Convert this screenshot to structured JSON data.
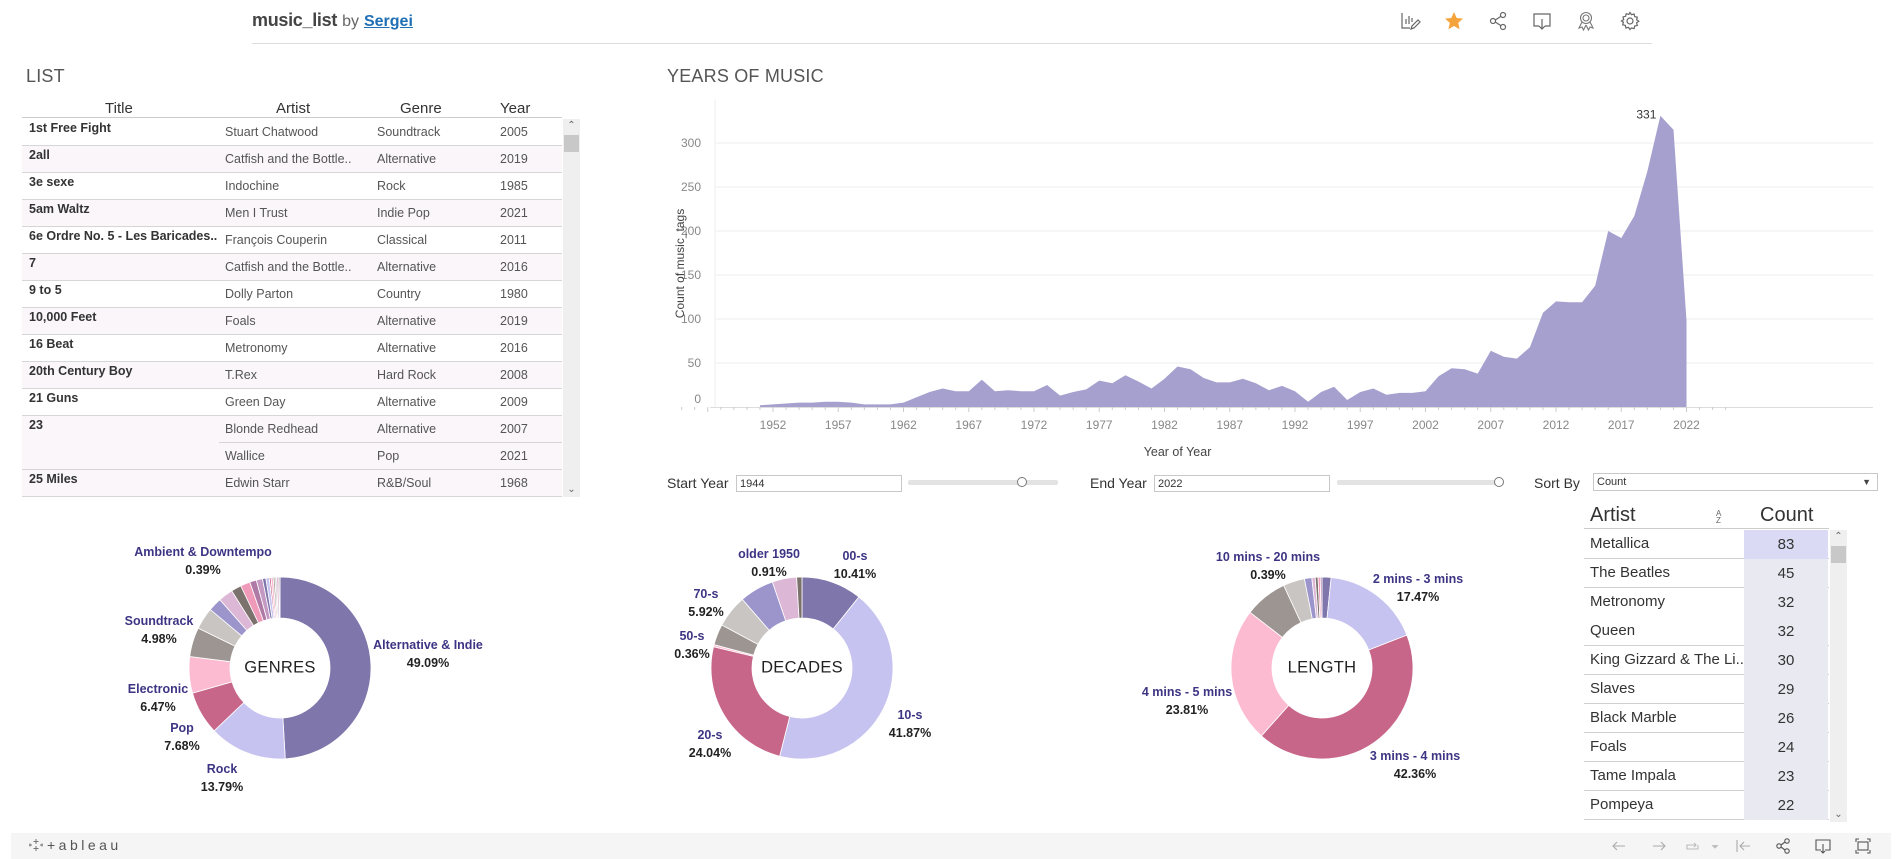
{
  "header": {
    "workbook_name": "music_list",
    "by_label": "by",
    "author": "Sergei",
    "icons": [
      "edit-viz-icon",
      "favorite-star-icon",
      "share-icon",
      "download-icon",
      "badge-icon",
      "settings-gear-icon"
    ],
    "star_color": "#f5a43b"
  },
  "list": {
    "title": "LIST",
    "columns": [
      "Title",
      "Artist",
      "Genre",
      "Year"
    ],
    "rows": [
      {
        "title": "1st Free Fight",
        "artist": "Stuart Chatwood",
        "genre": "Soundtrack",
        "year": "2005"
      },
      {
        "title": "2all",
        "artist": "Catfish and the Bottle..",
        "genre": "Alternative",
        "year": "2019"
      },
      {
        "title": "3e sexe",
        "artist": "Indochine",
        "genre": "Rock",
        "year": "1985"
      },
      {
        "title": "5am Waltz",
        "artist": "Men I Trust",
        "genre": "Indie Pop",
        "year": "2021"
      },
      {
        "title": "6e Ordre No. 5 - Les Baricades..",
        "artist": "François Couperin",
        "genre": "Classical",
        "year": "2011"
      },
      {
        "title": "7",
        "artist": "Catfish and the Bottle..",
        "genre": "Alternative",
        "year": "2016"
      },
      {
        "title": "9 to 5",
        "artist": "Dolly Parton",
        "genre": "Country",
        "year": "1980"
      },
      {
        "title": "10,000 Feet",
        "artist": "Foals",
        "genre": "Alternative",
        "year": "2019"
      },
      {
        "title": "16 Beat",
        "artist": "Metronomy",
        "genre": "Alternative",
        "year": "2016"
      },
      {
        "title": "20th Century Boy",
        "artist": "T.Rex",
        "genre": "Hard Rock",
        "year": "2008"
      },
      {
        "title": "21 Guns",
        "artist": "Green Day",
        "genre": "Alternative",
        "year": "2009"
      },
      {
        "title": "23",
        "artist": "Blonde Redhead",
        "genre": "Alternative",
        "year": "2007"
      },
      {
        "title": "",
        "artist": "Wallice",
        "genre": "Pop",
        "year": "2021"
      },
      {
        "title": "25 Miles",
        "artist": "Edwin Starr",
        "genre": "R&B/Soul",
        "year": "1968"
      }
    ]
  },
  "years_section": {
    "title": "YEARS OF MUSIC"
  },
  "filters": {
    "start_year_label": "Start Year",
    "start_year_value": "1944",
    "start_slider_fraction": 0.76,
    "end_year_label": "End Year",
    "end_year_value": "2022",
    "end_slider_fraction": 1.0,
    "sort_by_label": "Sort By",
    "sort_by_value": "Count"
  },
  "artists": {
    "columns": [
      "Artist",
      "Count"
    ],
    "sort_icon": "sort-az-icon",
    "rows": [
      {
        "artist": "Metallica",
        "count": "83"
      },
      {
        "artist": "The Beatles",
        "count": "45"
      },
      {
        "artist": "Metronomy",
        "count": "32"
      },
      {
        "artist": "Queen",
        "count": "32"
      },
      {
        "artist": "King Gizzard & The Li..",
        "count": "30"
      },
      {
        "artist": "Slaves",
        "count": "29"
      },
      {
        "artist": "Black Marble",
        "count": "26"
      },
      {
        "artist": "Foals",
        "count": "24"
      },
      {
        "artist": "Tame Impala",
        "count": "23"
      },
      {
        "artist": "Pompeya",
        "count": "22"
      }
    ]
  },
  "footer": {
    "logo_text": "+ableau",
    "icons": [
      "undo-icon",
      "redo-icon",
      "revert-icon",
      "revert-dropdown-icon",
      "reset-icon",
      "share-icon",
      "download-icon",
      "fullscreen-icon"
    ]
  },
  "chart_data": [
    {
      "type": "area",
      "title": "YEARS OF MUSIC",
      "xlabel": "Year of Year",
      "ylabel": "Count of music_tags",
      "ylim": [
        0,
        345
      ],
      "xlim": [
        1944,
        2025
      ],
      "yticks": [
        0,
        50,
        100,
        150,
        200,
        250,
        300
      ],
      "xticks": [
        1952,
        1957,
        1962,
        1967,
        1972,
        1977,
        1982,
        1987,
        1992,
        1997,
        2002,
        2007,
        2012,
        2017,
        2022
      ],
      "grid": true,
      "color": "#a5a0ce",
      "annotation": {
        "x": 2020,
        "y": 331,
        "text": "331"
      },
      "x": [
        1951,
        1952,
        1953,
        1954,
        1955,
        1956,
        1957,
        1958,
        1959,
        1960,
        1961,
        1962,
        1963,
        1964,
        1965,
        1966,
        1967,
        1968,
        1969,
        1970,
        1971,
        1972,
        1973,
        1974,
        1975,
        1976,
        1977,
        1978,
        1979,
        1980,
        1981,
        1982,
        1983,
        1984,
        1985,
        1986,
        1987,
        1988,
        1989,
        1990,
        1991,
        1992,
        1993,
        1994,
        1995,
        1996,
        1997,
        1998,
        1999,
        2000,
        2001,
        2002,
        2003,
        2004,
        2005,
        2006,
        2007,
        2008,
        2009,
        2010,
        2011,
        2012,
        2013,
        2014,
        2015,
        2016,
        2017,
        2018,
        2019,
        2020,
        2021,
        2022
      ],
      "values": [
        2,
        3,
        4,
        5,
        5,
        6,
        6,
        5,
        3,
        3,
        3,
        5,
        11,
        17,
        21,
        18,
        18,
        31,
        18,
        19,
        18,
        18,
        25,
        13,
        17,
        20,
        30,
        27,
        36,
        29,
        21,
        32,
        46,
        43,
        33,
        28,
        28,
        32,
        27,
        19,
        24,
        18,
        6,
        17,
        23,
        8,
        17,
        21,
        14,
        16,
        16,
        18,
        35,
        44,
        43,
        38,
        64,
        57,
        55,
        68,
        107,
        120,
        119,
        119,
        138,
        200,
        192,
        217,
        268,
        331,
        315,
        98
      ]
    },
    {
      "type": "pie",
      "title": "GENRES",
      "slices": [
        {
          "label": "Alternative & Indie",
          "value": 49.09,
          "color": "#7f76ab",
          "show_label": true
        },
        {
          "label": "Rock",
          "value": 13.79,
          "color": "#c7c3f0",
          "show_label": true
        },
        {
          "label": "Pop",
          "value": 7.68,
          "color": "#c76688",
          "show_label": true
        },
        {
          "label": "Electronic",
          "value": 6.47,
          "color": "#fdbbd2",
          "show_label": true
        },
        {
          "label": "",
          "value": 5.2,
          "color": "#9d9591",
          "show_label": false
        },
        {
          "label": "",
          "value": 3.9,
          "color": "#c9c5c2",
          "show_label": false
        },
        {
          "label": "Soundtrack",
          "value": 2.4,
          "color": "#9b95cc",
          "show_label": true,
          "display_pct": "4.98%"
        },
        {
          "label": "",
          "value": 2.6,
          "color": "#dcb7d6",
          "show_label": false
        },
        {
          "label": "",
          "value": 1.8,
          "color": "#7b716d",
          "show_label": false
        },
        {
          "label": "",
          "value": 1.7,
          "color": "#f09aba",
          "show_label": false
        },
        {
          "label": "",
          "value": 1.2,
          "color": "#b07aa6",
          "show_label": false
        },
        {
          "label": "",
          "value": 1.1,
          "color": "#c499c3",
          "show_label": false
        },
        {
          "label": "",
          "value": 0.6,
          "color": "#7f76ab",
          "show_label": false
        },
        {
          "label": "",
          "value": 0.6,
          "color": "#c7c3f0",
          "show_label": false
        },
        {
          "label": "",
          "value": 0.3,
          "color": "#c76688",
          "show_label": false
        },
        {
          "label": "",
          "value": 0.4,
          "color": "#fdbbd2",
          "show_label": false
        },
        {
          "label": "",
          "value": 0.3,
          "color": "#9d9591",
          "show_label": false
        },
        {
          "label": "",
          "value": 0.3,
          "color": "#c9c5c2",
          "show_label": false
        },
        {
          "label": "Ambient & Downtempo",
          "value": 0.39,
          "color": "#dcb7d6",
          "show_label": true
        },
        {
          "label": "",
          "value": 0.2,
          "color": "#7b716d",
          "show_label": false
        }
      ],
      "labels": [
        {
          "name": "Alternative & Indie",
          "pct": "49.09%"
        },
        {
          "name": "Rock",
          "pct": "13.79%"
        },
        {
          "name": "Pop",
          "pct": "7.68%"
        },
        {
          "name": "Electronic",
          "pct": "6.47%"
        },
        {
          "name": "Soundtrack",
          "pct": "4.98%"
        },
        {
          "name": "Ambient & Downtempo",
          "pct": "0.39%"
        }
      ]
    },
    {
      "type": "pie",
      "title": "DECADES",
      "slices": [
        {
          "label": "00-s",
          "value": 10.41,
          "color": "#7f76ab"
        },
        {
          "label": "10-s",
          "value": 41.87,
          "color": "#c7c3f0"
        },
        {
          "label": "20-s",
          "value": 24.04,
          "color": "#c76688"
        },
        {
          "label": "50-s",
          "value": 0.36,
          "color": "#fdbbd2"
        },
        {
          "label": "",
          "value": 3.6,
          "color": "#9d9591"
        },
        {
          "label": "",
          "value": 5.6,
          "color": "#c9c5c2"
        },
        {
          "label": "70-s",
          "value": 5.92,
          "color": "#9b95cc"
        },
        {
          "label": "",
          "value": 4.2,
          "color": "#dcb7d6"
        },
        {
          "label": "older 1950",
          "value": 0.91,
          "color": "#7b716d"
        }
      ],
      "labels": [
        {
          "name": "00-s",
          "pct": "10.41%"
        },
        {
          "name": "10-s",
          "pct": "41.87%"
        },
        {
          "name": "20-s",
          "pct": "24.04%"
        },
        {
          "name": "50-s",
          "pct": "0.36%"
        },
        {
          "name": "70-s",
          "pct": "5.92%"
        },
        {
          "name": "older 1950",
          "pct": "0.91%"
        }
      ]
    },
    {
      "type": "pie",
      "title": "LENGTH",
      "slices": [
        {
          "label": "",
          "value": 1.6,
          "color": "#7f76ab"
        },
        {
          "label": "2 mins - 3 mins",
          "value": 17.47,
          "color": "#c7c3f0"
        },
        {
          "label": "3 mins - 4 mins",
          "value": 42.36,
          "color": "#c76688"
        },
        {
          "label": "4 mins - 5 mins",
          "value": 23.81,
          "color": "#fdbbd2"
        },
        {
          "label": "",
          "value": 7.6,
          "color": "#9d9591"
        },
        {
          "label": "",
          "value": 3.8,
          "color": "#c9c5c2"
        },
        {
          "label": "",
          "value": 1.3,
          "color": "#9b95cc"
        },
        {
          "label": "",
          "value": 0.6,
          "color": "#dcb7d6"
        },
        {
          "label": "",
          "value": 0.5,
          "color": "#7b716d"
        },
        {
          "label": "10 mins - 20 mins",
          "value": 0.39,
          "color": "#f09aba"
        },
        {
          "label": "",
          "value": 0.3,
          "color": "#b07aa6"
        }
      ],
      "labels": [
        {
          "name": "2 mins - 3 mins",
          "pct": "17.47%"
        },
        {
          "name": "3 mins - 4 mins",
          "pct": "42.36%"
        },
        {
          "name": "4 mins - 5 mins",
          "pct": "23.81%"
        },
        {
          "name": "10 mins - 20 mins",
          "pct": "0.39%"
        }
      ]
    }
  ]
}
